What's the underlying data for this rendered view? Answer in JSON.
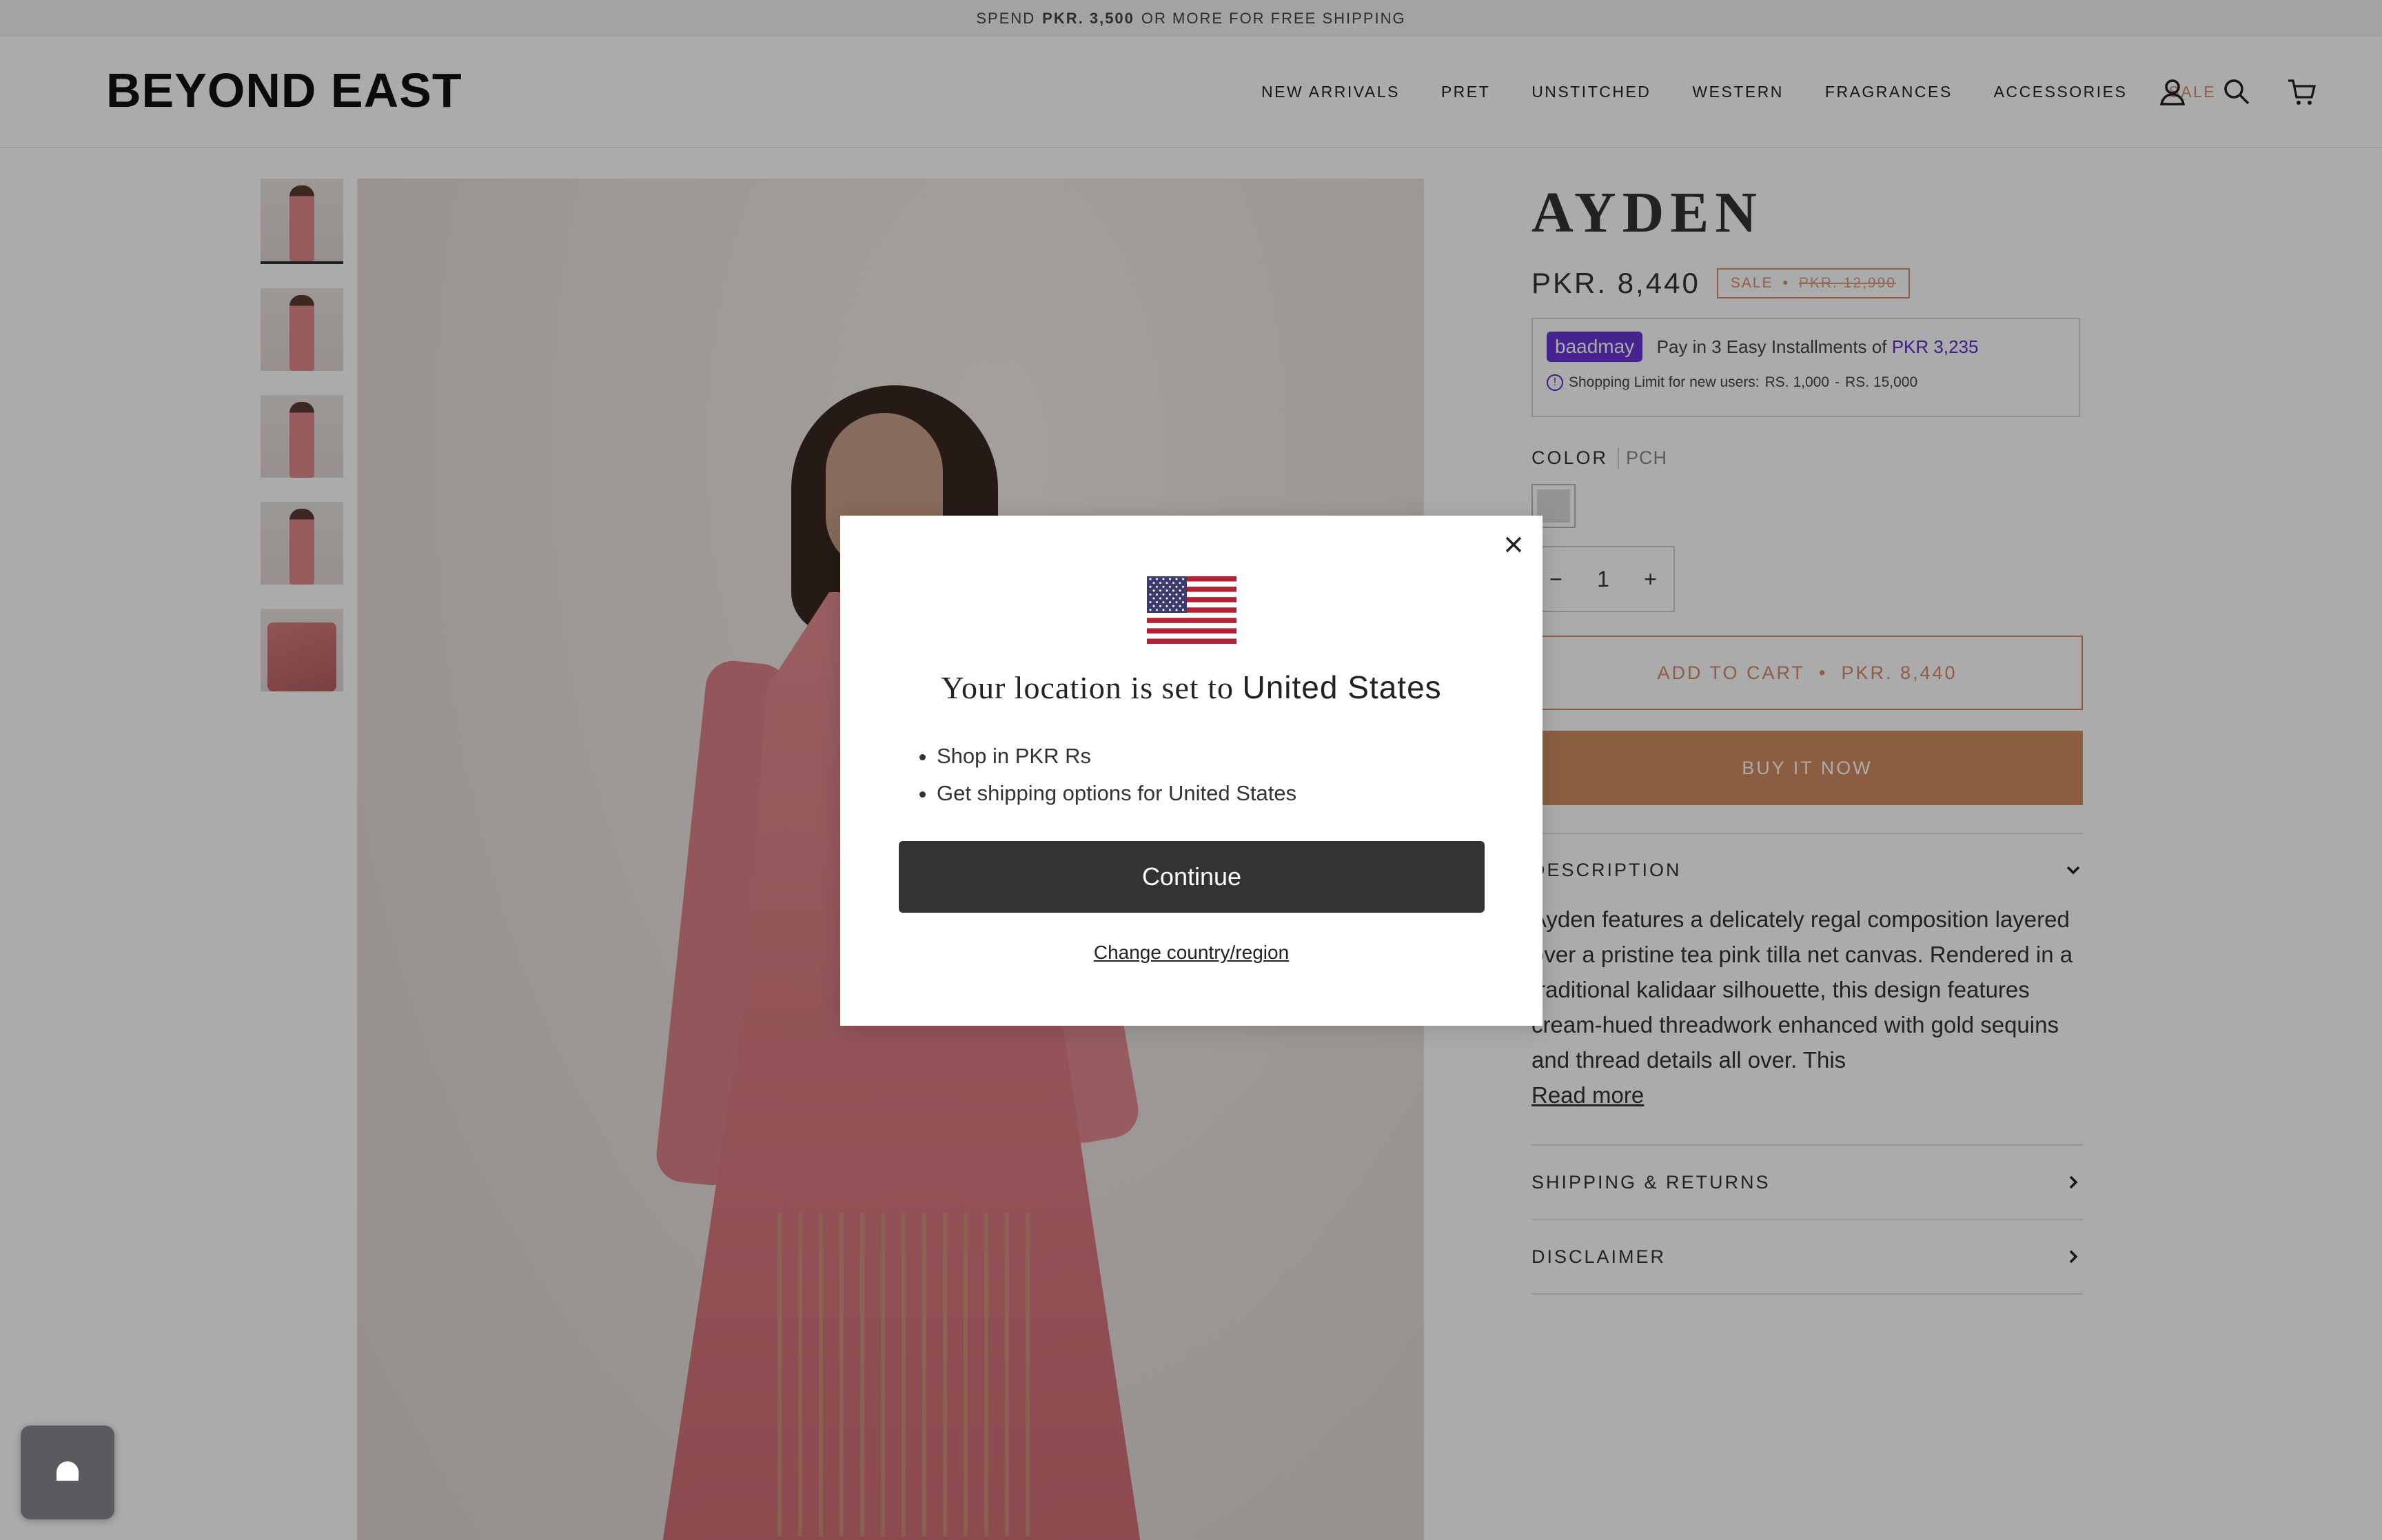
{
  "announcement": {
    "prefix": "SPEND",
    "amount": "PKR. 3,500",
    "suffix": "OR MORE FOR FREE SHIPPING"
  },
  "header": {
    "logo": "BEYOND EAST",
    "nav": [
      "NEW ARRIVALS",
      "PRET",
      "UNSTITCHED",
      "WESTERN",
      "FRAGRANCES",
      "ACCESSORIES",
      "SALE"
    ],
    "icons": [
      "account-icon",
      "search-icon",
      "cart-icon"
    ]
  },
  "product": {
    "title": "AYDEN",
    "price": "PKR. 8,440",
    "sale_label": "SALE",
    "sale_dot": "•",
    "old_price": "PKR. 12,990",
    "baadmay": {
      "logo": "baadmay",
      "text": "Pay in 3 Easy Installments of",
      "amount": "PKR 3,235",
      "limit_label": "Shopping Limit for new users:",
      "limit_min": "RS. 1,000",
      "limit_sep": "-",
      "limit_max": "RS. 15,000"
    },
    "color_label": "COLOR",
    "color_value": "PCH",
    "quantity": {
      "minus": "−",
      "value": "1",
      "plus": "+"
    },
    "add_to_cart": "ADD TO CART",
    "add_to_cart_dot": "•",
    "add_to_cart_price": "PKR. 8,440",
    "buy_now": "BUY IT NOW",
    "description_heading": "DESCRIPTION",
    "description": "Ayden features a delicately regal composition layered over a pristine tea pink tilla net canvas. Rendered in a traditional kalidaar silhouette, this design features cream-hued threadwork enhanced with gold sequins and thread details all over. This",
    "read_more": "Read more",
    "shipping_heading": "SHIPPING & RETURNS",
    "disclaimer_heading": "DISCLAIMER"
  },
  "modal": {
    "title_prefix": "Your location is set to",
    "country": "United States",
    "bullets": [
      "Shop in PKR Rs",
      "Get shipping options for United States"
    ],
    "continue": "Continue",
    "change": "Change country/region"
  },
  "colors": {
    "accent": "#d48a6a",
    "buy_button": "#cf8c63",
    "baadmay": "#6a35d6",
    "modal_button": "#333333"
  }
}
